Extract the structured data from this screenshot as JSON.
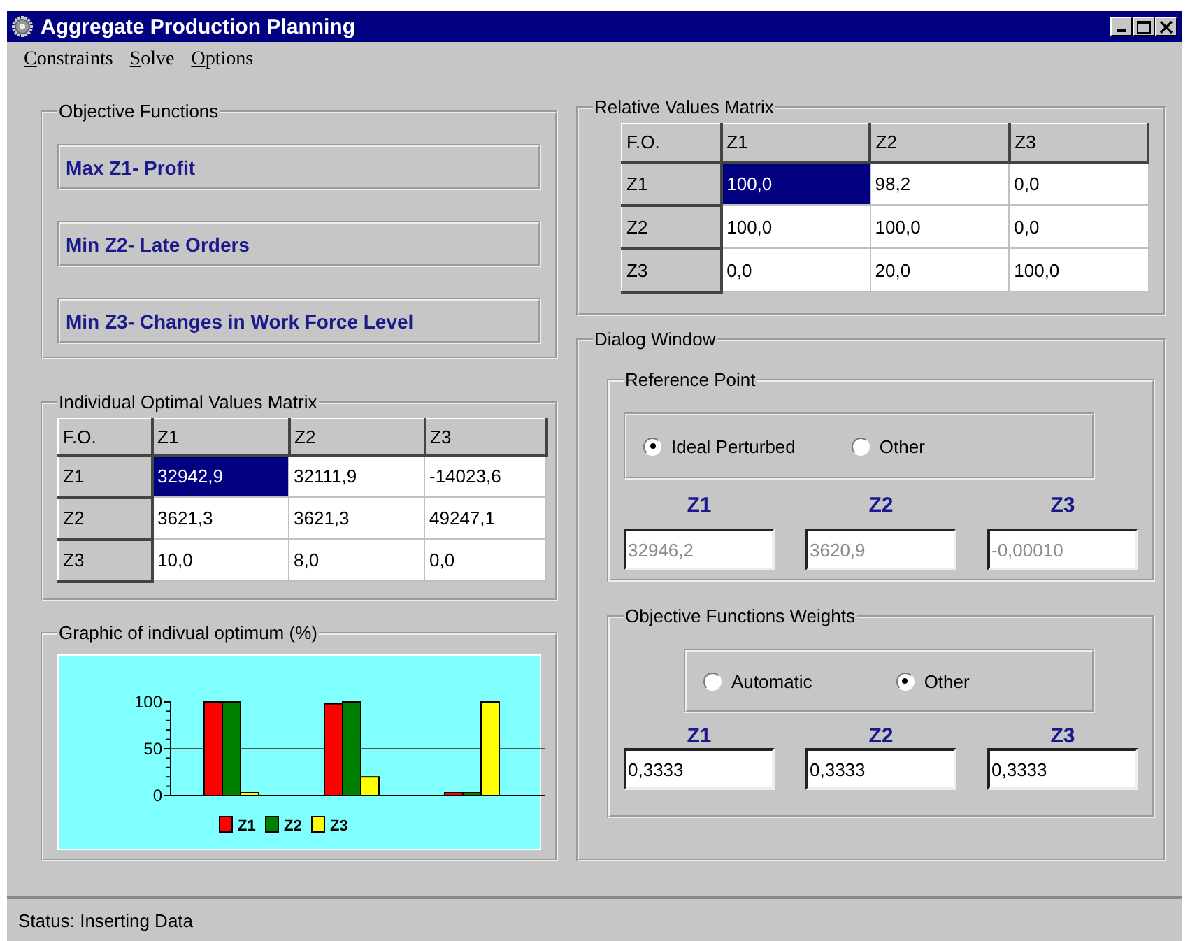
{
  "window": {
    "title": "Aggregate Production Planning"
  },
  "menu": [
    {
      "label": "Constraints"
    },
    {
      "label": "Solve"
    },
    {
      "label": "Options"
    }
  ],
  "objective_functions": {
    "title": "Objective Functions",
    "items": [
      "Max Z1- Profit",
      "Min Z2- Late Orders",
      "Min Z3- Changes in Work Force Level"
    ]
  },
  "optimal_matrix": {
    "title": "Individual Optimal Values Matrix",
    "corner": "F.O.",
    "columns": [
      "Z1",
      "Z2",
      "Z3"
    ],
    "rows": [
      {
        "label": "Z1",
        "cells": [
          {
            "text": "32942,9",
            "selected": true
          },
          {
            "text": "32111,9",
            "selected": false
          },
          {
            "text": "-14023,6",
            "selected": false
          }
        ]
      },
      {
        "label": "Z2",
        "cells": [
          {
            "text": "3621,3",
            "selected": false
          },
          {
            "text": "3621,3",
            "selected": false
          },
          {
            "text": "49247,1",
            "selected": false
          }
        ]
      },
      {
        "label": "Z3",
        "cells": [
          {
            "text": "10,0",
            "selected": false
          },
          {
            "text": "8,0",
            "selected": false
          },
          {
            "text": "0,0",
            "selected": false
          }
        ]
      }
    ]
  },
  "graphic": {
    "title": "Graphic of indivual optimum (%)",
    "chart_data": {
      "type": "bar",
      "ylim": [
        0,
        100
      ],
      "yticks": [
        0,
        50,
        100
      ],
      "legend": "bottom",
      "series": [
        {
          "name": "Z1",
          "color": "#ff0000",
          "values": [
            100,
            98,
            0
          ]
        },
        {
          "name": "Z2",
          "color": "#008000",
          "values": [
            100,
            100,
            0
          ]
        },
        {
          "name": "Z3",
          "color": "#ffff00",
          "values": [
            0,
            20,
            100
          ]
        }
      ]
    }
  },
  "relative_matrix": {
    "title": "Relative Values Matrix",
    "corner": "F.O.",
    "columns": [
      "Z1",
      "Z2",
      "Z3"
    ],
    "rows": [
      {
        "label": "Z1",
        "cells": [
          {
            "text": "100,0",
            "selected": true
          },
          {
            "text": "98,2",
            "selected": false
          },
          {
            "text": "0,0",
            "selected": false
          }
        ]
      },
      {
        "label": "Z2",
        "cells": [
          {
            "text": "100,0",
            "selected": false
          },
          {
            "text": "100,0",
            "selected": false
          },
          {
            "text": "0,0",
            "selected": false
          }
        ]
      },
      {
        "label": "Z3",
        "cells": [
          {
            "text": "0,0",
            "selected": false
          },
          {
            "text": "20,0",
            "selected": false
          },
          {
            "text": "100,0",
            "selected": false
          }
        ]
      }
    ]
  },
  "dialog": {
    "title": "Dialog Window",
    "sections": [
      {
        "title": "Reference Point",
        "options": [
          {
            "label": "Ideal Perturbed",
            "selected": true
          },
          {
            "label": "Other",
            "selected": false
          }
        ],
        "fields": [
          {
            "label": "Z1",
            "value": "32946,2",
            "disabled": true
          },
          {
            "label": "Z2",
            "value": "3620,9",
            "disabled": true
          },
          {
            "label": "Z3",
            "value": "-0,00010",
            "disabled": true
          }
        ]
      },
      {
        "title": "Objective Functions Weights",
        "options": [
          {
            "label": "Automatic",
            "selected": false
          },
          {
            "label": "Other",
            "selected": true
          }
        ],
        "fields": [
          {
            "label": "Z1",
            "value": "0,3333",
            "disabled": false
          },
          {
            "label": "Z2",
            "value": "0,3333",
            "disabled": false
          },
          {
            "label": "Z3",
            "value": "0,3333",
            "disabled": false
          }
        ]
      }
    ]
  },
  "status_bar": "Status: Inserting Data"
}
